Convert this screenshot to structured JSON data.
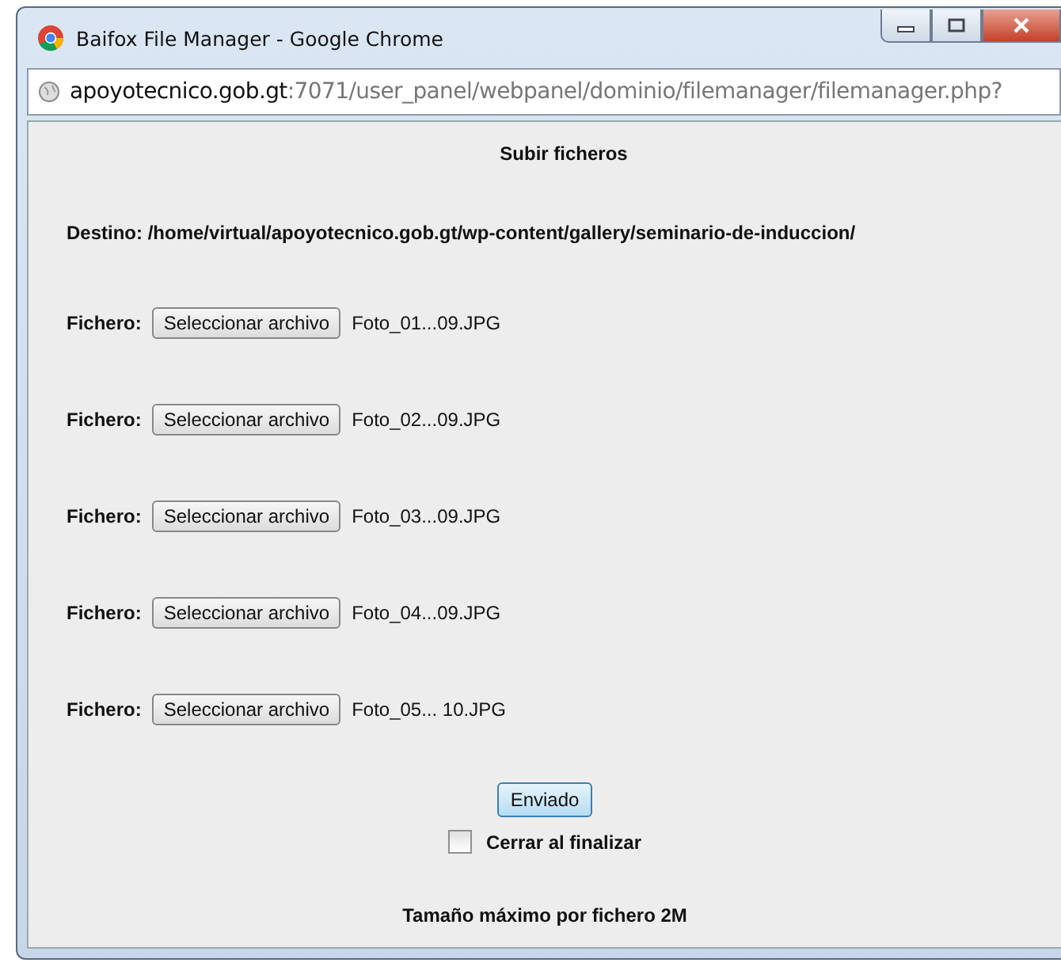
{
  "window": {
    "title": "Baifox File Manager - Google Chrome"
  },
  "address_bar": {
    "host": "apoyotecnico.gob.gt",
    "path": ":7071/user_panel/webpanel/dominio/filemanager/filemanager.php?"
  },
  "heading": "Subir ficheros",
  "destination": {
    "label": "Destino:",
    "path": "/home/virtual/apoyotecnico.gob.gt/wp-content/gallery/seminario-de-induccion/"
  },
  "files": [
    {
      "label": "Fichero:",
      "button": "Seleccionar archivo",
      "file_name": "Foto_01...09.JPG"
    },
    {
      "label": "Fichero:",
      "button": "Seleccionar archivo",
      "file_name": "Foto_02...09.JPG"
    },
    {
      "label": "Fichero:",
      "button": "Seleccionar archivo",
      "file_name": "Foto_03...09.JPG"
    },
    {
      "label": "Fichero:",
      "button": "Seleccionar archivo",
      "file_name": "Foto_04...09.JPG"
    },
    {
      "label": "Fichero:",
      "button": "Seleccionar archivo",
      "file_name": "Foto_05... 10.JPG"
    }
  ],
  "submit_button": "Enviado",
  "close_on_finish": {
    "label": "Cerrar al finalizar",
    "checked": false
  },
  "footer": "Tamaño máximo por fichero 2M"
}
